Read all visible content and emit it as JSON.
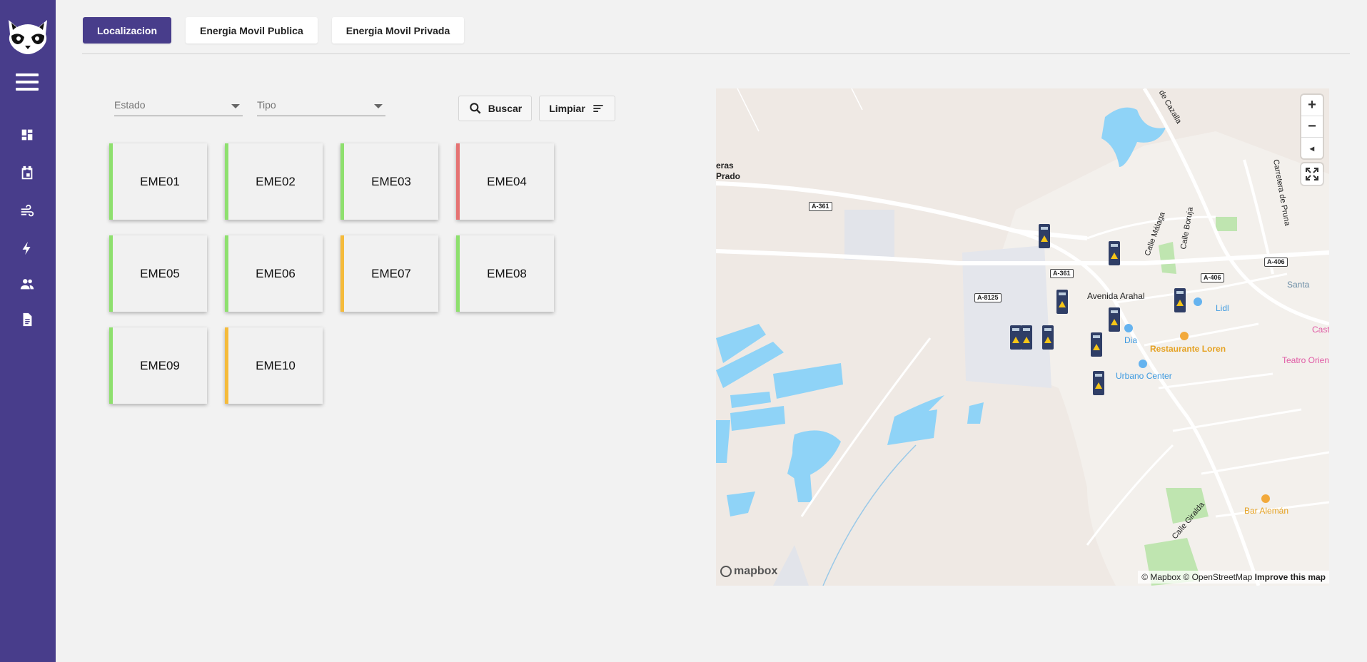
{
  "tabs": [
    {
      "label": "Localizacion",
      "active": true
    },
    {
      "label": "Energia Movil Publica",
      "active": false
    },
    {
      "label": "Energia Movil Privada",
      "active": false
    }
  ],
  "filters": {
    "estado_label": "Estado",
    "tipo_label": "Tipo",
    "buscar_label": "Buscar",
    "limpiar_label": "Limpiar"
  },
  "nav_icons": [
    "menu-icon",
    "dashboard-icon",
    "calendar-icon",
    "wind-icon",
    "bolt-icon",
    "users-icon",
    "document-icon"
  ],
  "status_colors": {
    "ok": "#8ee06e",
    "warning": "#f5bb3b",
    "error": "#e57373"
  },
  "stations": [
    {
      "id": "EME01",
      "status": "ok"
    },
    {
      "id": "EME02",
      "status": "ok"
    },
    {
      "id": "EME03",
      "status": "ok"
    },
    {
      "id": "EME04",
      "status": "error"
    },
    {
      "id": "EME05",
      "status": "ok"
    },
    {
      "id": "EME06",
      "status": "ok"
    },
    {
      "id": "EME07",
      "status": "warning"
    },
    {
      "id": "EME08",
      "status": "ok"
    },
    {
      "id": "EME09",
      "status": "ok"
    },
    {
      "id": "EME10",
      "status": "warning"
    }
  ],
  "map": {
    "zoom_in": "+",
    "zoom_out": "−",
    "compass": "◂",
    "logo": "mapbox",
    "attribution": "© Mapbox © OpenStreetMap",
    "improve": "Improve this map",
    "labels": {
      "place_left_1": "eras",
      "place_left_2": "Prado",
      "road_a361_a": "A-361",
      "road_a361_b": "A-361",
      "road_a8125": "A-8125",
      "road_a406_a": "A-406",
      "road_a406_b": "A-406",
      "avenida": "Avenida Arahal",
      "calle_malaga": "Calle Málaga",
      "calle_boruja": "Calle Boruja",
      "carretera_pruna": "Carretera de Pruna",
      "de_cazalla": "de Cazalla",
      "lidl": "Lidl",
      "dia": "Dia",
      "restaurante": "Restaurante Loren",
      "urbano": "Urbano Center",
      "santa": "Santa",
      "cast": "Cast",
      "teatro": "Teatro Orien",
      "bar_aleman": "Bar Alemán",
      "calle_giralda": "Calle Giralda"
    }
  }
}
